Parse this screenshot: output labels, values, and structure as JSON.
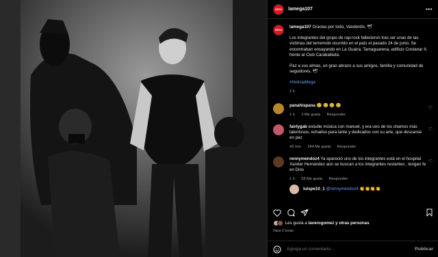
{
  "header": {
    "logo_text": "MEGA",
    "username": "lamega107",
    "more": "•••"
  },
  "caption": {
    "username": "lamega107",
    "first_line": "Gracias por todo, Vanderdis. 🕊",
    "paragraph_1": "Los integrantes del grupo de rap-rock fallecieron tras ser unas de las víctimas del terremoto ocurrido en el país el pasado 24 de junio. Se encontraban ensayando en La Guaira, Tamaguarena, edificio Costanar II, frente al Club Caraballeda.",
    "paragraph_2": "Paz a sus almas, un gran abrazo a sus amigos, familia y comunidad de seguidores. 🕊",
    "hashtag": "#NoticiaMega",
    "time": "2 h"
  },
  "comments": [
    {
      "username": "panahispana",
      "text": "😢 😢 😢 😢",
      "time": "1 h",
      "likes": "2 Me gusta",
      "reply": "Responder",
      "avatar_color": "#b8862a"
    },
    {
      "username": "fairlygab",
      "text": "estudie música con manuel, y era uno de los chamos más talentosos, echados para lante y dedicados con su arte, que descanse en paz",
      "time": "43 min",
      "likes": "244 Me gusta",
      "reply": "Responder",
      "avatar_color": "#c4586a"
    },
    {
      "username": "rennymendoz4",
      "text": "Ya apareció uno de los integrantes está en el hospital Xander Hernández aún se buscan a los integrantes restantes , tengan fe en Dios",
      "time": "1 h",
      "likes": "59 Me gusta",
      "reply": "Responder",
      "avatar_color": "#5a3a22"
    }
  ],
  "reply": {
    "username": "luispe10_1",
    "mention": "@rennymendoz4",
    "text": "👏👏👏👏",
    "avatar_color": "#d9b9a7"
  },
  "likes": {
    "prefix": "Les gusta a",
    "user": "laverogomez",
    "suffix": "y otras personas"
  },
  "ago": "Hace 2 horas",
  "comment_box": {
    "placeholder": "Agrega un comentario...",
    "post_label": "Publicar"
  },
  "colors": {
    "brand": "#e5141b",
    "link": "#6a9fff",
    "background": "#000000",
    "text": "#f5f5f5",
    "muted": "#a8a8a8"
  }
}
